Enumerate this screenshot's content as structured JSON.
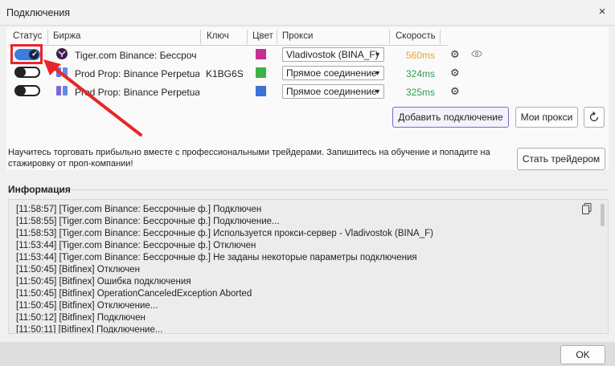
{
  "window": {
    "title": "Подключения",
    "close_glyph": "×"
  },
  "table": {
    "headers": {
      "status": "Статус",
      "exchange": "Биржа",
      "key": "Ключ",
      "color": "Цвет",
      "proxy": "Прокси",
      "speed": "Скорость"
    },
    "rows": [
      {
        "enabled": true,
        "exchange": "Tiger.com Binance: Бессрочн",
        "key": "",
        "color": "#c4308f",
        "proxy": "Vladivostok (BINA_F)",
        "speed": "560ms",
        "speed_color": "#e6a23c"
      },
      {
        "enabled": false,
        "exchange": "Prod Prop: Binance Perpetual",
        "key": "K1BG6S",
        "color": "#3bb34a",
        "proxy": "Прямое соединение",
        "speed": "324ms",
        "speed_color": "#2e9e4f"
      },
      {
        "enabled": false,
        "exchange": "Prod Prop: Binance Perpetual",
        "key": "",
        "color": "#3a72d9",
        "proxy": "Прямое соединение",
        "speed": "325ms",
        "speed_color": "#2e9e4f"
      }
    ]
  },
  "buttons": {
    "add_connection": "Добавить подключение",
    "my_proxies": "Мои прокси",
    "become_trader": "Стать трейдером",
    "ok": "OK"
  },
  "promo_text": "Научитесь торговать прибыльно вместе с профессиональными трейдерами. Запишитесь на обучение и попадите на стажировку от проп-компании!",
  "info": {
    "title": "Информация",
    "log": [
      "[11:58:57] [Tiger.com Binance: Бессрочные ф.] Подключен",
      "[11:58:55] [Tiger.com Binance: Бессрочные ф.] Подключение...",
      "[11:58:53] [Tiger.com Binance: Бессрочные ф.] Используется прокси-сервер - Vladivostok (BINA_F)",
      "[11:53:44] [Tiger.com Binance: Бессрочные ф.] Отключен",
      "[11:53:44] [Tiger.com Binance: Бессрочные ф.] Не заданы некоторые параметры подключения",
      "[11:50:45] [Bitfinex] Отключен",
      "[11:50:45] [Bitfinex] Ошибка подключения",
      "[11:50:45] [Bitfinex] OperationCanceledException Aborted",
      "[11:50:45] [Bitfinex] Отключение...",
      "[11:50:12] [Bitfinex] Подключен",
      "[11:50:11] [Bitfinex] Подключение..."
    ]
  },
  "annotation": {
    "highlight_color": "#e8262a"
  }
}
